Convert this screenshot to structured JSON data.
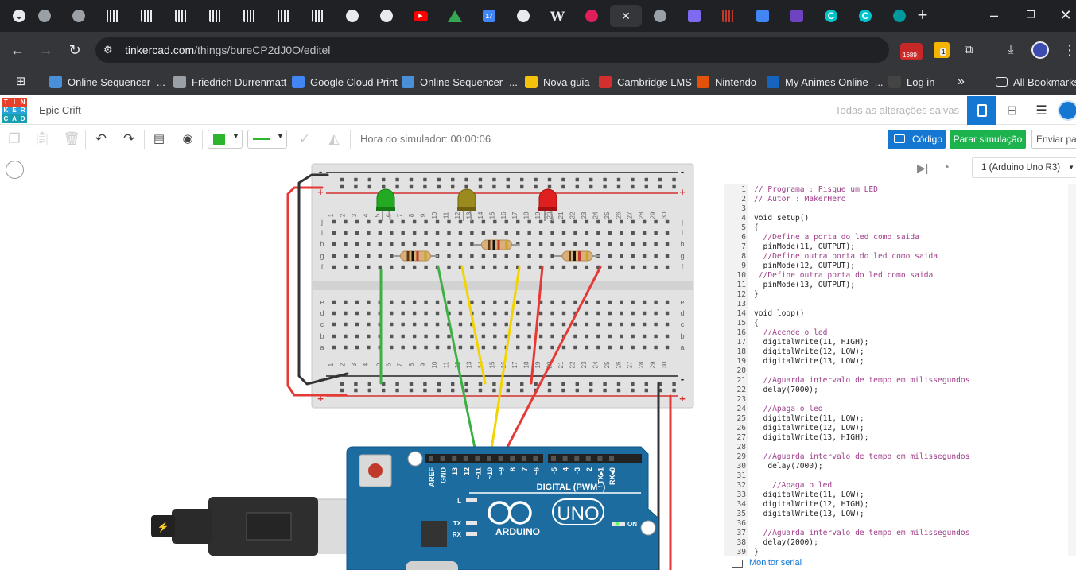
{
  "browser": {
    "tabs": [
      {
        "icon": "chevron-down-icon",
        "color": "#202124"
      },
      {
        "icon": "globe-icon",
        "color": "#9aa0a6"
      },
      {
        "icon": "globe-icon",
        "color": "#9aa0a6"
      },
      {
        "icon": "stripes-icon",
        "color": "#e8eaed"
      },
      {
        "icon": "stripes-icon",
        "color": "#e8eaed"
      },
      {
        "icon": "stripes-icon",
        "color": "#e8eaed"
      },
      {
        "icon": "stripes-icon",
        "color": "#e8eaed"
      },
      {
        "icon": "stripes-icon",
        "color": "#e8eaed"
      },
      {
        "icon": "stripes-icon",
        "color": "#e8eaed"
      },
      {
        "icon": "stripes-icon",
        "color": "#e8eaed"
      },
      {
        "icon": "github-icon",
        "color": "#e8eaed"
      },
      {
        "icon": "github-icon",
        "color": "#e8eaed"
      },
      {
        "icon": "youtube-icon",
        "color": "#ff0000"
      },
      {
        "icon": "drive-icon",
        "color": "#34a853"
      },
      {
        "icon": "calendar-icon",
        "color": "#4285f4",
        "label": "17"
      },
      {
        "icon": "github-icon",
        "color": "#e8eaed"
      },
      {
        "icon": "w-icon",
        "color": "#e8eaed",
        "label": "W"
      },
      {
        "icon": "slack-icon",
        "color": "#e01e5a"
      },
      {
        "icon": "close-icon",
        "color": "#e8eaed",
        "active": true
      },
      {
        "icon": "globe-icon",
        "color": "#9aa0a6"
      },
      {
        "icon": "app-icon",
        "color": "#7c6bf0"
      },
      {
        "icon": "stripes-icon",
        "color": "#c0392b"
      },
      {
        "icon": "docs-icon",
        "color": "#4285f4"
      },
      {
        "icon": "app-icon",
        "color": "#6f42c1"
      },
      {
        "icon": "canva-icon",
        "color": "#00c4cc",
        "label": "C"
      },
      {
        "icon": "canva-icon",
        "color": "#00c4cc",
        "label": "C"
      },
      {
        "icon": "infinity-icon",
        "color": "#00979d"
      }
    ],
    "url_host": "tinkercad.com",
    "url_path": "/things/bureCP2dJ0O/editel",
    "extension_badge": "1689",
    "extension_badge_2": "1",
    "bookmarks": [
      {
        "label": "Online Sequencer -...",
        "color": "#4a90d9"
      },
      {
        "label": "Friedrich Dürrenmatt",
        "color": "#9aa0a6"
      },
      {
        "label": "Google Cloud Print",
        "color": "#4285f4"
      },
      {
        "label": "Online Sequencer -...",
        "color": "#4a90d9"
      },
      {
        "label": "Nova guia",
        "color": "#f4c20d"
      },
      {
        "label": "Cambridge LMS",
        "color": "#d32f2f"
      },
      {
        "label": "Nintendo",
        "color": "#e4510b"
      },
      {
        "label": "My Animes Online -...",
        "color": "#1565c0"
      },
      {
        "label": "Log in",
        "color": "#444"
      }
    ],
    "bookmarks_more": "»",
    "all_bookmarks": "All Bookmarks"
  },
  "tinkercad": {
    "logo_letters": [
      "T",
      "I",
      "N",
      "K",
      "E",
      "R",
      "C",
      "A",
      "D"
    ],
    "logo_colors": [
      "#e8412b",
      "#e8412b",
      "#e8412b",
      "#2aa3d8",
      "#2aa3d8",
      "#2aa3d8",
      "#18a0b0",
      "#18a0b0",
      "#18a0b0"
    ],
    "project_name": "Epic Crift",
    "save_status": "Todas as alterações salvas",
    "sim_time_label": "Hora do simulador: 00:00:06",
    "code_button": "Código",
    "stop_sim_button": "Parar simulação",
    "send_button": "Enviar para",
    "color_swatch": "#2db52d",
    "board_select": "1 (Arduino Uno R3)",
    "serial_monitor": "Monitor serial"
  },
  "breadboard": {
    "columns": [
      "1",
      "2",
      "3",
      "4",
      "5",
      "6",
      "7",
      "8",
      "9",
      "10",
      "11",
      "12",
      "13",
      "14",
      "15",
      "16",
      "17",
      "18",
      "19",
      "20",
      "21",
      "22",
      "23",
      "24",
      "25",
      "26",
      "27",
      "28",
      "29",
      "30"
    ],
    "rows_top": [
      "j",
      "i",
      "h",
      "g",
      "f"
    ],
    "rows_bottom": [
      "e",
      "d",
      "c",
      "b",
      "a"
    ],
    "rail_minus": "-",
    "rail_plus": "+"
  },
  "arduino": {
    "model": "UNO",
    "brand": "ARDUINO",
    "digital_label": "DIGITAL (PWM~)",
    "pins": [
      "AREF",
      "GND",
      "13",
      "12",
      "~11",
      "~10",
      "~9",
      "8",
      "7",
      "~6",
      "~5",
      "4",
      "~3",
      "2",
      "TX▸1",
      "RX◂0"
    ],
    "led_labels": [
      "L",
      "TX",
      "RX"
    ],
    "on_label": "ON"
  },
  "code": {
    "lines": [
      "// Programa : Pisque um LED",
      "// Autor : MakerHero",
      "",
      "void setup()",
      "{",
      "  //Define a porta do led como saida",
      "  pinMode(11, OUTPUT);",
      "  //Define outra porta do led como saida",
      "  pinMode(12, OUTPUT);",
      " //Define outra porta do led como saida",
      "  pinMode(13, OUTPUT);",
      "}",
      "",
      "void loop()",
      "{",
      "  //Acende o led",
      "  digitalWrite(11, HIGH);",
      "  digitalWrite(12, LOW);",
      "  digitalWrite(13, LOW);",
      "",
      "  //Aguarda intervalo de tempo em milissegundos",
      "  delay(7000);",
      "",
      "  //Apaga o led",
      "  digitalWrite(11, LOW);",
      "  digitalWrite(12, LOW);",
      "  digitalWrite(13, HIGH);",
      "",
      "  //Aguarda intervalo de tempo em milissegundos",
      "   delay(7000);",
      "",
      "    //Apaga o led",
      "  digitalWrite(11, LOW);",
      "  digitalWrite(12, HIGH);",
      "  digitalWrite(13, LOW);",
      "",
      "  //Aguarda intervalo de tempo em milissegundos",
      "  delay(2000);",
      "}"
    ]
  }
}
